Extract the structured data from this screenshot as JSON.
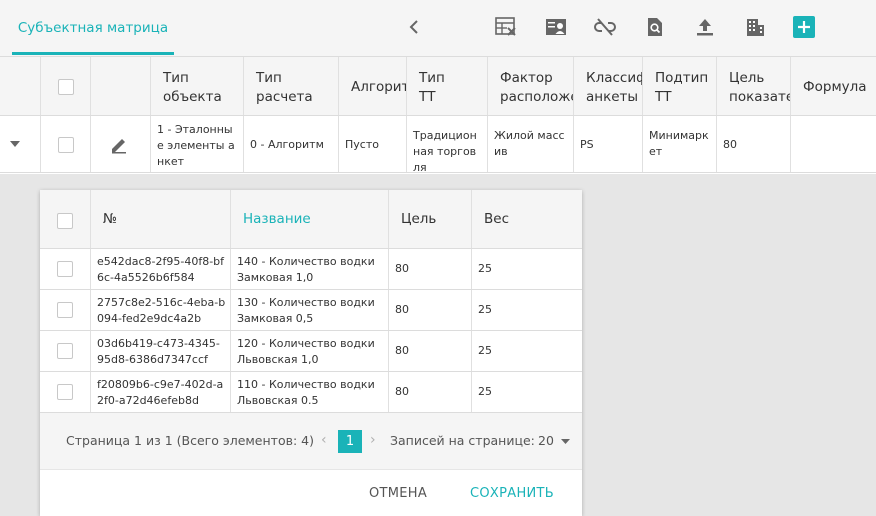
{
  "tab": {
    "label": "Субъектная матрица"
  },
  "toolbar": {
    "icons": [
      "chevron-left-icon",
      "table-remove-icon",
      "user-card-icon",
      "unlink-icon",
      "file-search-icon",
      "upload-icon",
      "building-icon",
      "add-icon"
    ]
  },
  "grid": {
    "headers": {
      "type": "Тип\nобъекта",
      "calc": "Тип\nрасчета",
      "algo": "Алгоритм",
      "tt": "Тип\nТТ",
      "factor": "Фактор\nрасположения",
      "classif": "Классификатор\nанкеты",
      "subtype": "Подтип\nТТ",
      "target": "Цель\nпоказателя",
      "formula": "Формула"
    },
    "row": {
      "type": "1 - Эталонные элементы анкет",
      "calc": "0 - Алгоритм",
      "algo": "Пусто",
      "tt": "Традиционная торговля",
      "factor": "Жилой массив",
      "classif": "PS",
      "subtype": "Минимаркет",
      "target": "80",
      "formula": ""
    }
  },
  "detail": {
    "headers": {
      "num": "№",
      "name": "Название",
      "target": "Цель",
      "weight": "Вес"
    },
    "rows": [
      {
        "id": "e542dac8-2f95-40f8-bf6c-4a5526b6f584",
        "name": "140 - Количество водки Замковая 1,0",
        "target": "80",
        "weight": "25"
      },
      {
        "id": "2757c8e2-516c-4eba-b094-fed2e9dc4a2b",
        "name": "130 - Количество водки Замковая 0,5",
        "target": "80",
        "weight": "25"
      },
      {
        "id": "03d6b419-c473-4345-95d8-6386d7347ccf",
        "name": "120 - Количество водки Львовская 1,0",
        "target": "80",
        "weight": "25"
      },
      {
        "id": "f20809b6-c9e7-402d-a2f0-a72d46efeb8d",
        "name": "110 - Количество водки Львовская 0.5",
        "target": "80",
        "weight": "25"
      }
    ],
    "pager": {
      "info": "Страница 1 из 1 (Всего элементов: 4)",
      "prev": "‹",
      "page": "1",
      "next": "›",
      "size_label": "Записей на странице:",
      "size": "20"
    },
    "buttons": {
      "cancel": "ОТМЕНА",
      "save": "СОХРАНИТЬ"
    }
  },
  "colors": {
    "accent": "#1ab3b8"
  }
}
